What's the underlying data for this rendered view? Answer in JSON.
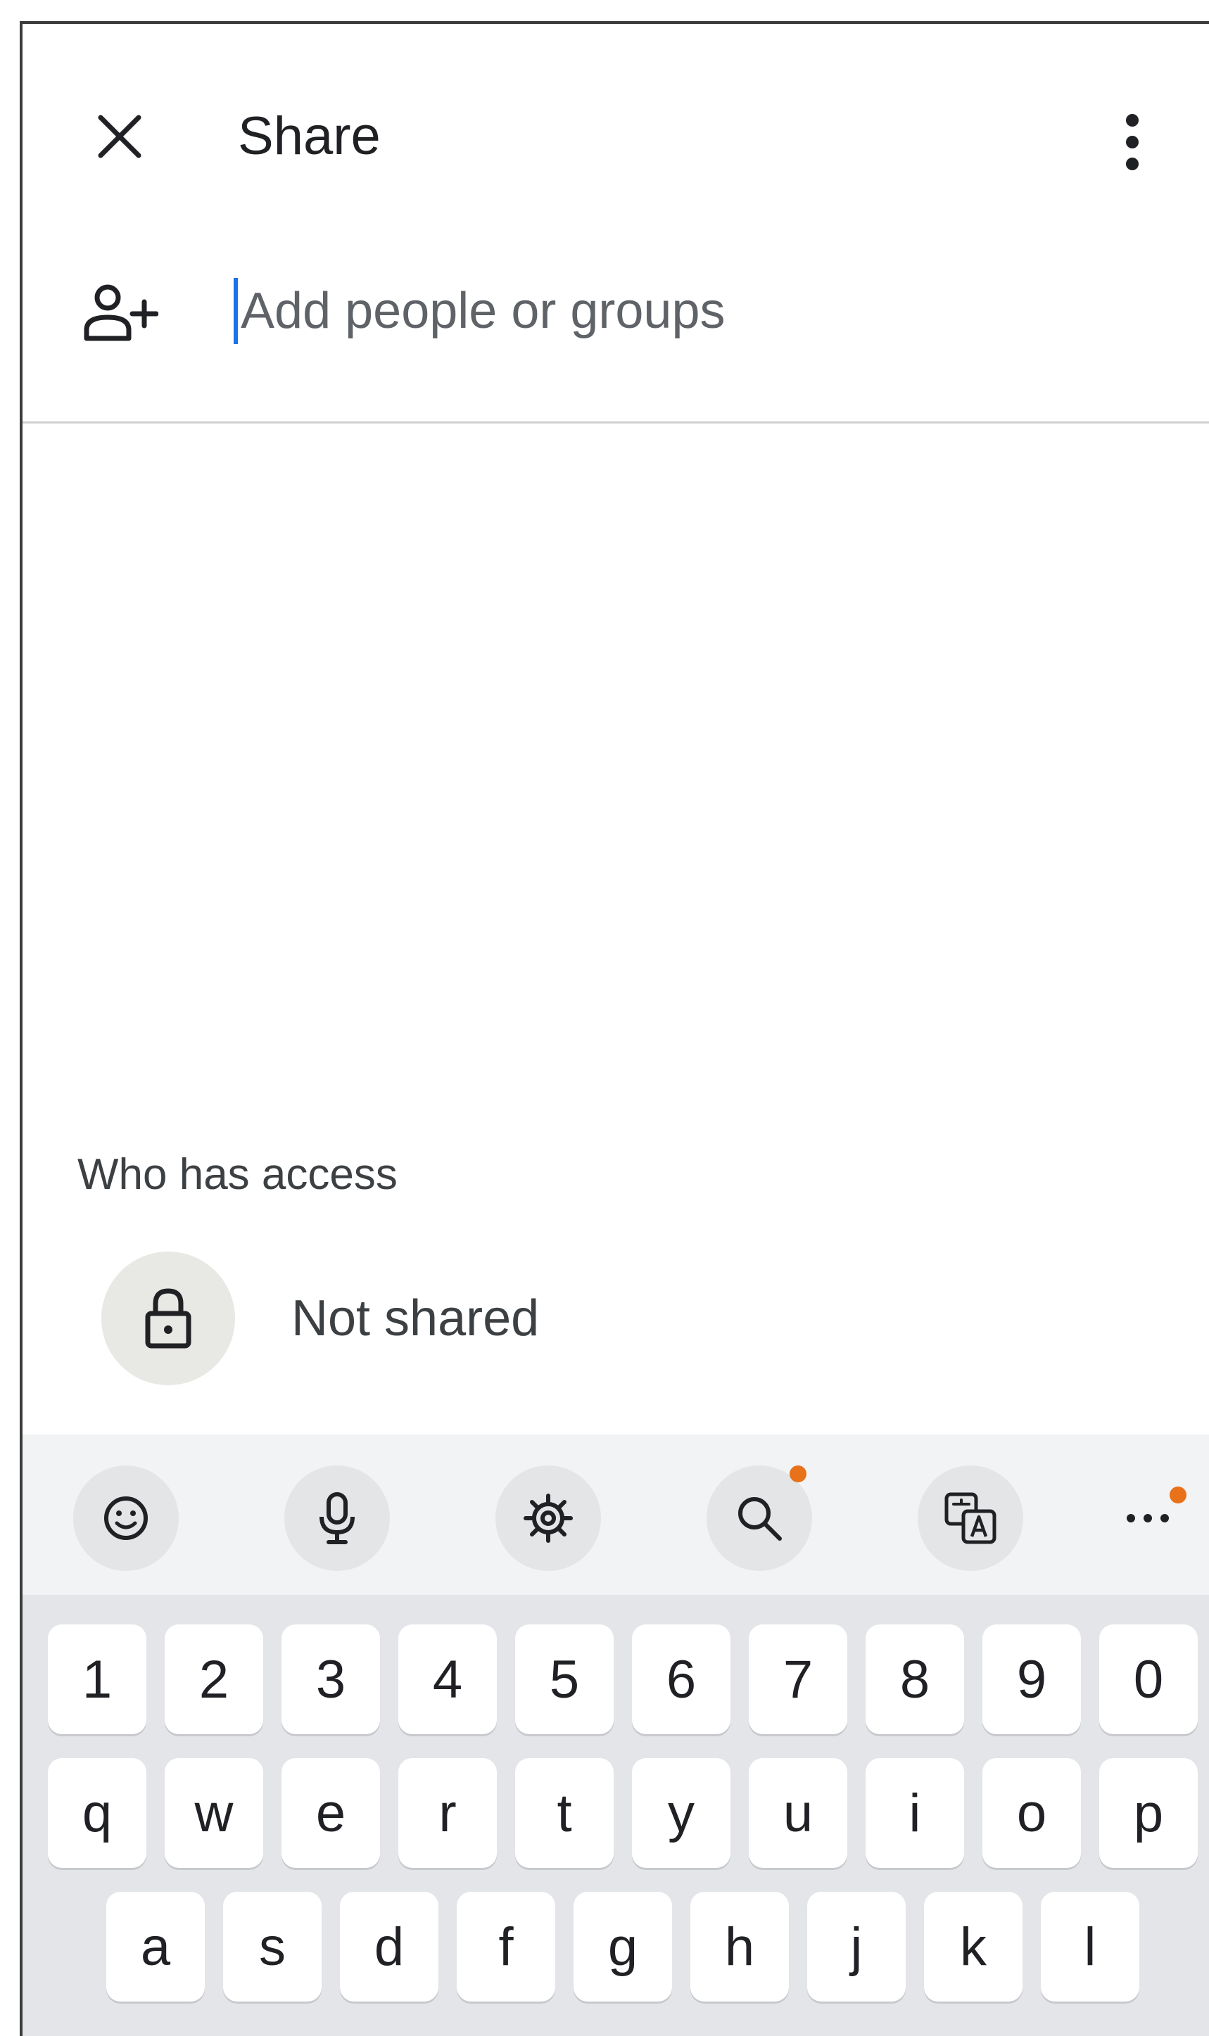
{
  "header": {
    "title": "Share",
    "close_icon": "close-icon",
    "more_icon": "more-vertical-icon"
  },
  "add_people": {
    "icon": "person-add-icon",
    "placeholder": "Add people or groups",
    "value": ""
  },
  "access": {
    "heading": "Who has access",
    "status_icon": "lock-icon",
    "status_label": "Not shared"
  },
  "keyboard_toolbar": {
    "items": [
      {
        "icon": "emoji-icon",
        "notification": false
      },
      {
        "icon": "microphone-icon",
        "notification": false
      },
      {
        "icon": "settings-gear-icon",
        "notification": false
      },
      {
        "icon": "search-icon",
        "notification": true
      },
      {
        "icon": "translate-icon",
        "notification": false
      },
      {
        "icon": "more-horizontal-icon",
        "notification": true
      }
    ],
    "notification_color": "#e8711a"
  },
  "keyboard": {
    "rows": [
      [
        "1",
        "2",
        "3",
        "4",
        "5",
        "6",
        "7",
        "8",
        "9",
        "0"
      ],
      [
        "q",
        "w",
        "e",
        "r",
        "t",
        "y",
        "u",
        "i",
        "o",
        "p"
      ],
      [
        "a",
        "s",
        "d",
        "f",
        "g",
        "h",
        "j",
        "k",
        "l"
      ]
    ]
  },
  "colors": {
    "accent": "#1a73e8",
    "text": "#202124",
    "secondary_text": "#5f6368"
  }
}
